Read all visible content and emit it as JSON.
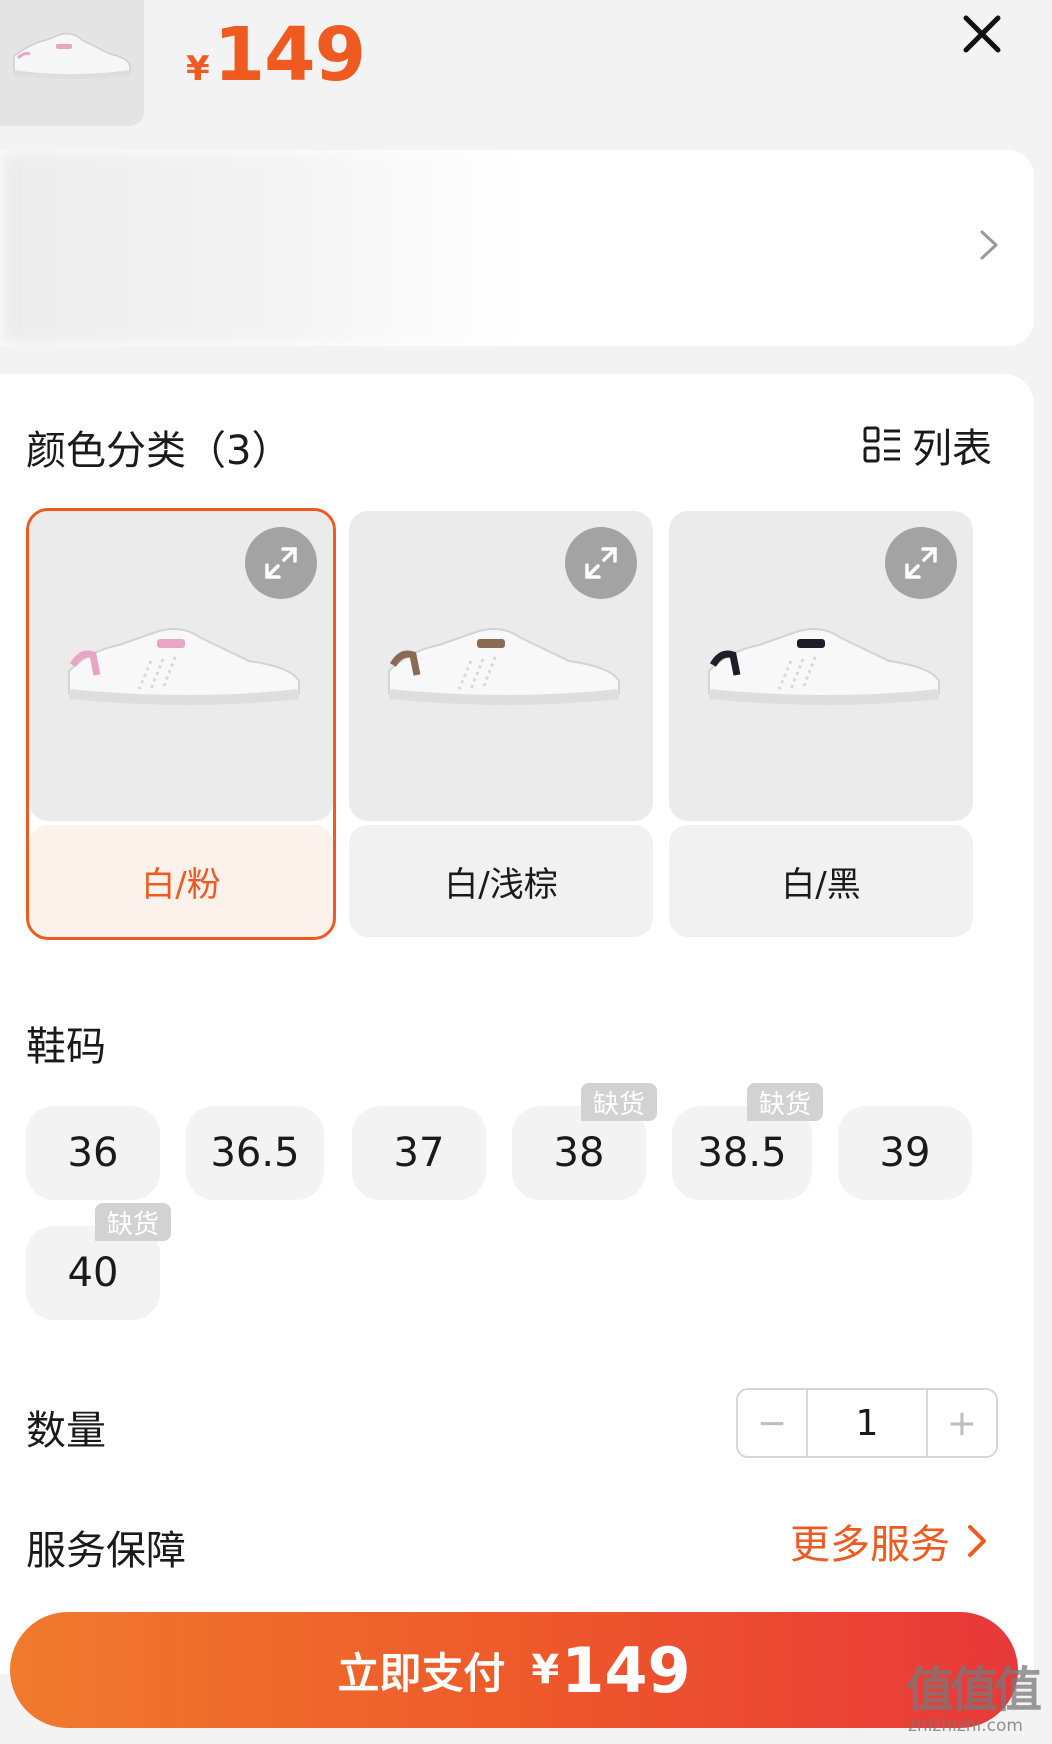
{
  "header": {
    "price_symbol": "¥",
    "price": "149",
    "close_icon": "close-icon",
    "accent_color": "#ee5a1f"
  },
  "address": {
    "arrow_icon": "chevron-right-icon"
  },
  "color_section": {
    "title": "颜色分类（3）",
    "list_toggle_label": "列表",
    "list_icon": "list-view-icon",
    "options": [
      {
        "label": "白/粉",
        "selected": true,
        "accent": "#e8a6c4"
      },
      {
        "label": "白/浅棕",
        "selected": false,
        "accent": "#8a6a52"
      },
      {
        "label": "白/黑",
        "selected": false,
        "accent": "#1e1e28"
      }
    ]
  },
  "size_section": {
    "title": "鞋码",
    "out_of_stock_label": "缺货",
    "sizes": [
      {
        "label": "36",
        "selected": false,
        "out_of_stock": false
      },
      {
        "label": "36.5",
        "selected": false,
        "out_of_stock": false
      },
      {
        "label": "37",
        "selected": true,
        "out_of_stock": false
      },
      {
        "label": "38",
        "selected": false,
        "out_of_stock": true
      },
      {
        "label": "38.5",
        "selected": false,
        "out_of_stock": true
      },
      {
        "label": "39",
        "selected": false,
        "out_of_stock": false
      },
      {
        "label": "40",
        "selected": false,
        "out_of_stock": true
      }
    ]
  },
  "quantity_section": {
    "title": "数量",
    "minus": "−",
    "value": "1",
    "plus": "+"
  },
  "service_section": {
    "title": "服务保障",
    "more_label": "更多服务"
  },
  "pay_button": {
    "label": "立即支付",
    "price_symbol": "¥",
    "price": "149"
  },
  "watermark": {
    "text": "值值值",
    "subtext": "zhizhizhi.com"
  }
}
